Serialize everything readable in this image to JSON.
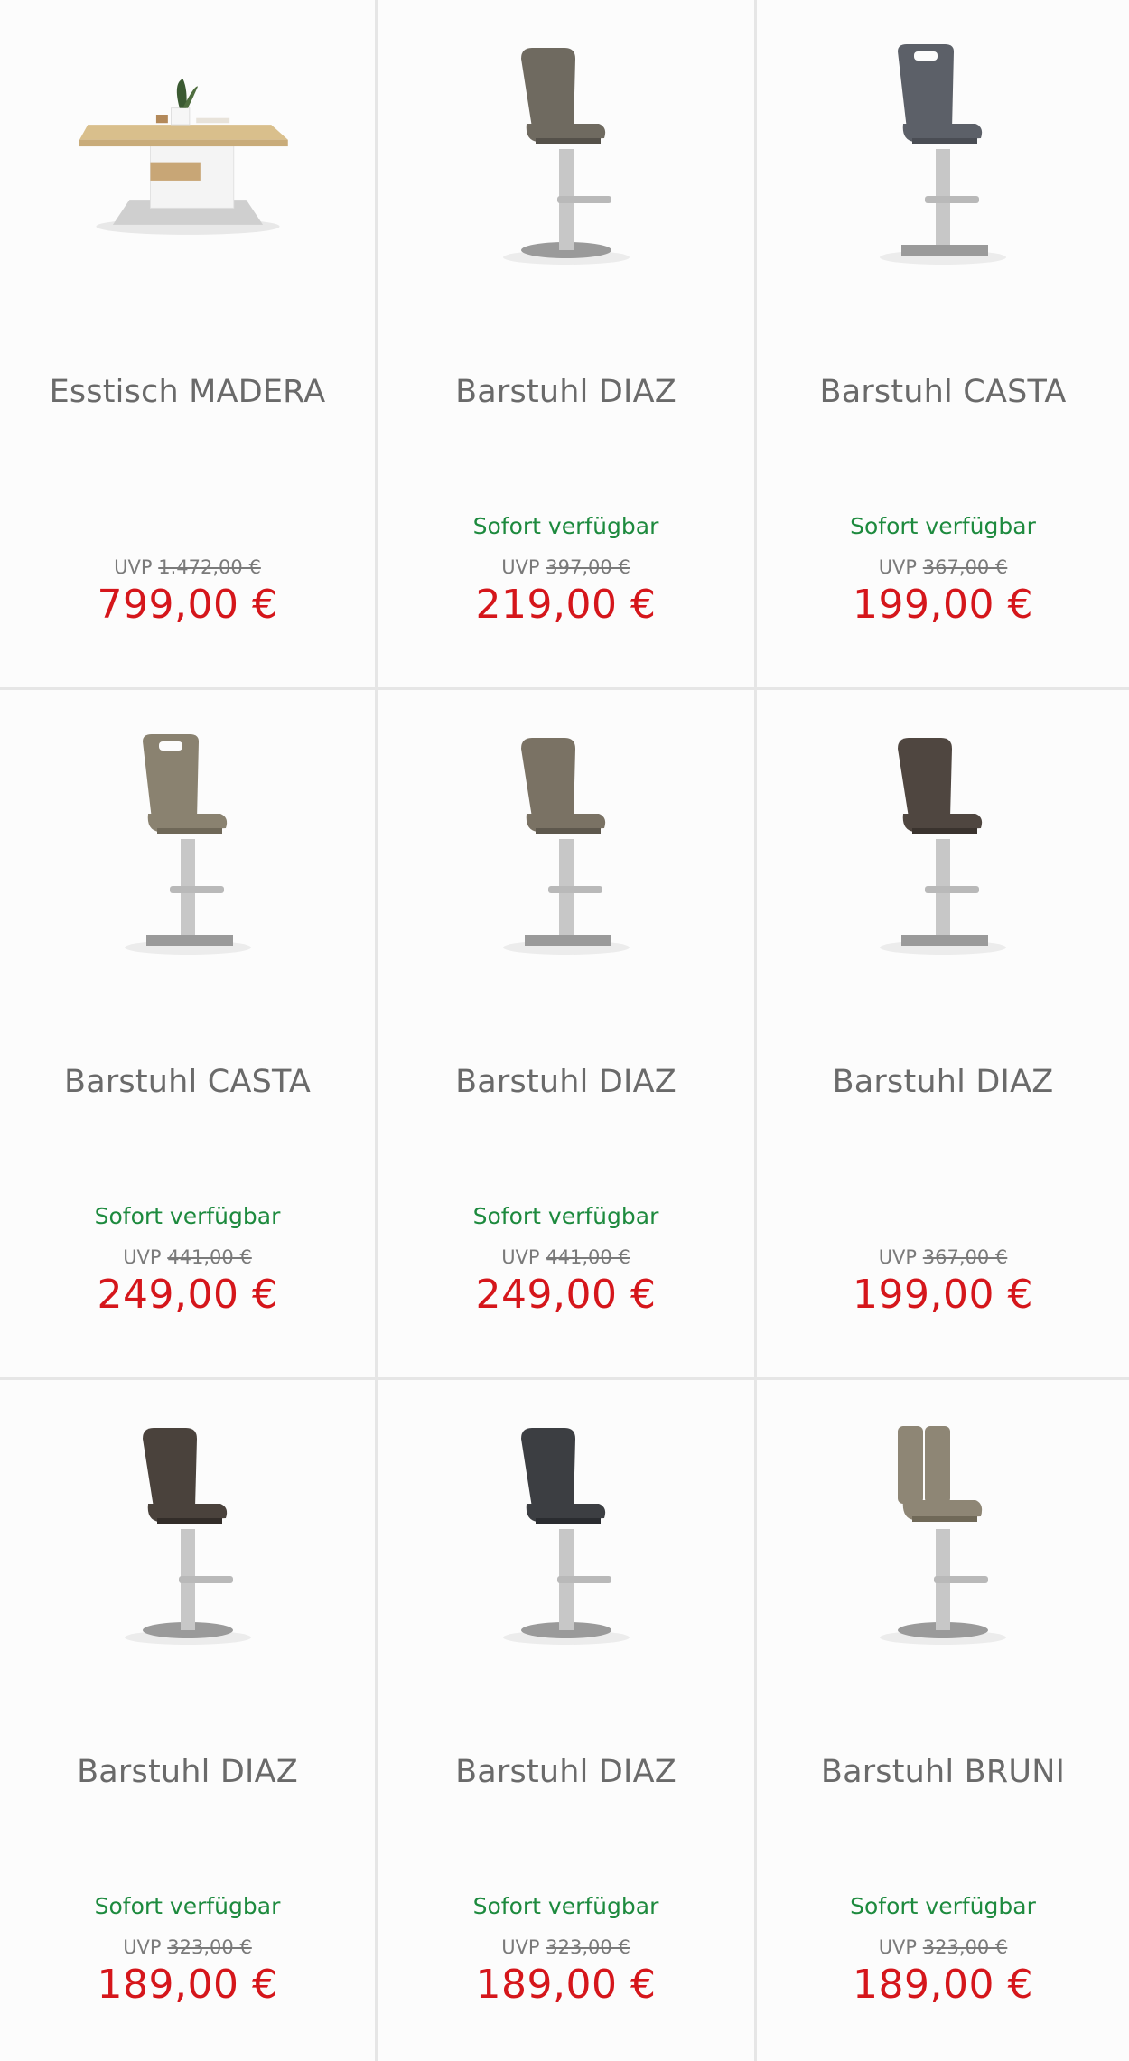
{
  "products": [
    {
      "name": "Esstisch MADERA",
      "availability": "",
      "uvp_label": "UVP",
      "uvp_price": "1.472,00 €",
      "price": "799,00 €",
      "image": "dining-table",
      "seat_color": "#c8b48a"
    },
    {
      "name": "Barstuhl DIAZ",
      "availability": "Sofort verfügbar",
      "uvp_label": "UVP",
      "uvp_price": "397,00 €",
      "price": "219,00 €",
      "image": "bar-stool",
      "seat_color": "#6f6a60"
    },
    {
      "name": "Barstuhl CASTA",
      "availability": "Sofort verfügbar",
      "uvp_label": "UVP",
      "uvp_price": "367,00 €",
      "price": "199,00 €",
      "image": "bar-stool-handle",
      "seat_color": "#5c6068"
    },
    {
      "name": "Barstuhl CASTA",
      "availability": "Sofort verfügbar",
      "uvp_label": "UVP",
      "uvp_price": "441,00 €",
      "price": "249,00 €",
      "image": "bar-stool-handle",
      "seat_color": "#8a8270"
    },
    {
      "name": "Barstuhl DIAZ",
      "availability": "Sofort verfügbar",
      "uvp_label": "UVP",
      "uvp_price": "441,00 €",
      "price": "249,00 €",
      "image": "bar-stool",
      "seat_color": "#7a7264"
    },
    {
      "name": "Barstuhl DIAZ",
      "availability": "",
      "uvp_label": "UVP",
      "uvp_price": "367,00 €",
      "price": "199,00 €",
      "image": "bar-stool",
      "seat_color": "#4f4640"
    },
    {
      "name": "Barstuhl DIAZ",
      "availability": "Sofort verfügbar",
      "uvp_label": "UVP",
      "uvp_price": "323,00 €",
      "price": "189,00 €",
      "image": "bar-stool",
      "seat_color": "#4a423c"
    },
    {
      "name": "Barstuhl DIAZ",
      "availability": "Sofort verfügbar",
      "uvp_label": "UVP",
      "uvp_price": "323,00 €",
      "price": "189,00 €",
      "image": "bar-stool",
      "seat_color": "#3c3e42"
    },
    {
      "name": "Barstuhl BRUNI",
      "availability": "Sofort verfügbar",
      "uvp_label": "UVP",
      "uvp_price": "323,00 €",
      "price": "189,00 €",
      "image": "bar-stool-split-back",
      "seat_color": "#8e8675"
    }
  ]
}
